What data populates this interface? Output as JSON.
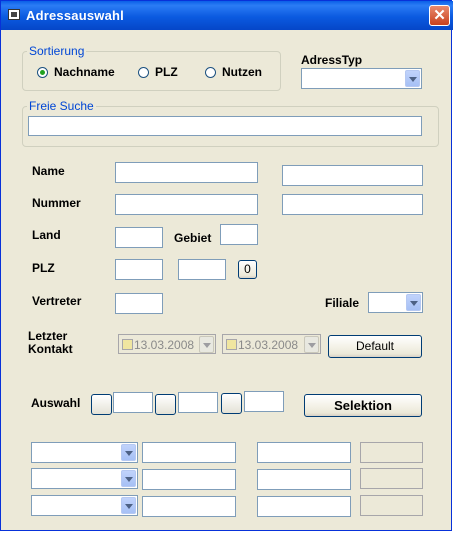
{
  "window": {
    "title": "Adressauswahl",
    "close_symbol": "✕"
  },
  "sortierung": {
    "legend": "Sortierung",
    "options": [
      {
        "label": "Nachname",
        "checked": true
      },
      {
        "label": "PLZ",
        "checked": false
      },
      {
        "label": "Nutzen",
        "checked": false
      }
    ]
  },
  "adresstyp": {
    "label": "AdressTyp",
    "value": ""
  },
  "freie_suche": {
    "legend": "Freie Suche",
    "value": ""
  },
  "fields": {
    "name_label": "Name",
    "nummer_label": "Nummer",
    "land_label": "Land",
    "gebiet_label": "Gebiet",
    "plz_label": "PLZ",
    "plz_button": "0",
    "vertreter_label": "Vertreter",
    "filiale_label": "Filiale",
    "letzter_kontakt_label_1": "Letzter",
    "letzter_kontakt_label_2": "Kontakt",
    "date_from": "13.03.2008",
    "date_to": "13.03.2008",
    "default_button": "Default",
    "auswahl_label": "Auswahl",
    "selektion_button": "Selektion"
  },
  "colors": {
    "title_bar": "#0a5fe8",
    "legend_text": "#0046d5",
    "window_bg": "#ece9d8",
    "radio_dot": "#21a121"
  }
}
